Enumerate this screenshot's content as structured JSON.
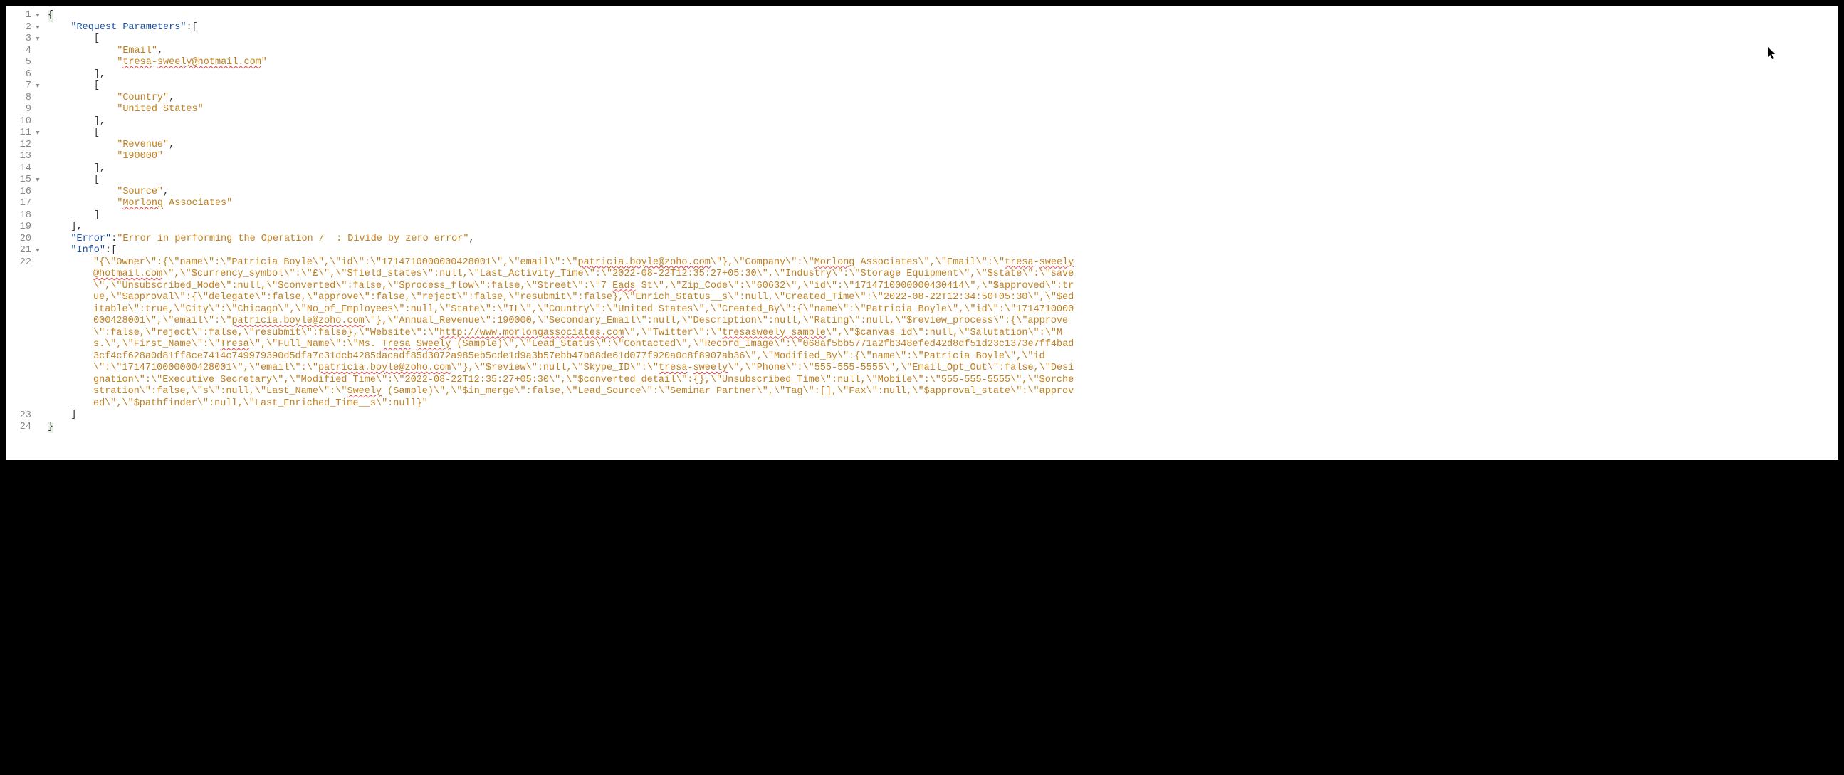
{
  "lines": [
    {
      "num": "1",
      "fold": "▼",
      "indent": 0,
      "segs": [
        {
          "t": "{",
          "c": "p hl"
        }
      ]
    },
    {
      "num": "2",
      "fold": "▼",
      "indent": 1,
      "segs": [
        {
          "t": "\"Request Parameters\"",
          "c": "k"
        },
        {
          "t": ":[",
          "c": "p"
        }
      ]
    },
    {
      "num": "3",
      "fold": "▼",
      "indent": 2,
      "segs": [
        {
          "t": "[",
          "c": "p"
        }
      ]
    },
    {
      "num": "4",
      "fold": "",
      "indent": 3,
      "segs": [
        {
          "t": "\"Email\"",
          "c": "s"
        },
        {
          "t": ",",
          "c": "p"
        }
      ]
    },
    {
      "num": "5",
      "fold": "",
      "indent": 3,
      "segs": [
        {
          "t": "\"",
          "c": "s"
        },
        {
          "t": "tresa",
          "c": "s squiggle"
        },
        {
          "t": "-",
          "c": "s"
        },
        {
          "t": "sweely@hotmail.com",
          "c": "s squiggle"
        },
        {
          "t": "\"",
          "c": "s"
        }
      ]
    },
    {
      "num": "6",
      "fold": "",
      "indent": 2,
      "segs": [
        {
          "t": "],",
          "c": "p"
        }
      ]
    },
    {
      "num": "7",
      "fold": "▼",
      "indent": 2,
      "segs": [
        {
          "t": "[",
          "c": "p"
        }
      ]
    },
    {
      "num": "8",
      "fold": "",
      "indent": 3,
      "segs": [
        {
          "t": "\"Country\"",
          "c": "s"
        },
        {
          "t": ",",
          "c": "p"
        }
      ]
    },
    {
      "num": "9",
      "fold": "",
      "indent": 3,
      "segs": [
        {
          "t": "\"United States\"",
          "c": "s"
        }
      ]
    },
    {
      "num": "10",
      "fold": "",
      "indent": 2,
      "segs": [
        {
          "t": "],",
          "c": "p"
        }
      ]
    },
    {
      "num": "11",
      "fold": "▼",
      "indent": 2,
      "segs": [
        {
          "t": "[",
          "c": "p"
        }
      ]
    },
    {
      "num": "12",
      "fold": "",
      "indent": 3,
      "segs": [
        {
          "t": "\"Revenue\"",
          "c": "s"
        },
        {
          "t": ",",
          "c": "p"
        }
      ]
    },
    {
      "num": "13",
      "fold": "",
      "indent": 3,
      "segs": [
        {
          "t": "\"190000\"",
          "c": "s"
        }
      ]
    },
    {
      "num": "14",
      "fold": "",
      "indent": 2,
      "segs": [
        {
          "t": "],",
          "c": "p"
        }
      ]
    },
    {
      "num": "15",
      "fold": "▼",
      "indent": 2,
      "segs": [
        {
          "t": "[",
          "c": "p"
        }
      ]
    },
    {
      "num": "16",
      "fold": "",
      "indent": 3,
      "segs": [
        {
          "t": "\"Source\"",
          "c": "s"
        },
        {
          "t": ",",
          "c": "p"
        }
      ]
    },
    {
      "num": "17",
      "fold": "",
      "indent": 3,
      "segs": [
        {
          "t": "\"",
          "c": "s"
        },
        {
          "t": "Morlong",
          "c": "s squiggle"
        },
        {
          "t": " Associates\"",
          "c": "s"
        }
      ]
    },
    {
      "num": "18",
      "fold": "",
      "indent": 2,
      "segs": [
        {
          "t": "]",
          "c": "p"
        }
      ]
    },
    {
      "num": "19",
      "fold": "",
      "indent": 1,
      "segs": [
        {
          "t": "],",
          "c": "p"
        }
      ]
    },
    {
      "num": "20",
      "fold": "",
      "indent": 1,
      "segs": [
        {
          "t": "\"Error\"",
          "c": "k"
        },
        {
          "t": ":",
          "c": "p"
        },
        {
          "t": "\"Error in performing the Operation /  : Divide by zero error\"",
          "c": "s"
        },
        {
          "t": ",",
          "c": "p"
        }
      ]
    },
    {
      "num": "21",
      "fold": "▼",
      "indent": 1,
      "segs": [
        {
          "t": "\"Info\"",
          "c": "k"
        },
        {
          "t": ":[",
          "c": "p"
        }
      ]
    }
  ],
  "line22": {
    "num": "22",
    "indent": 2,
    "segments": [
      {
        "t": "\"{\\\"Owner\\\":{\\\"name\\\":\\\"Patricia Boyle\\\",\\\"id\\\":\\\"1714710000000428001\\\",\\\"email\\\":\\\"",
        "sq": false
      },
      {
        "t": "patricia.boyle@zoho.com",
        "sq": true
      },
      {
        "t": "\\\"},\\\"Company\\\":\\\"",
        "sq": false
      },
      {
        "t": "Morlong",
        "sq": true
      },
      {
        "t": " Associates\\\",\\\"Email\\\":\\\"",
        "sq": false
      },
      {
        "t": "tresa",
        "sq": true
      },
      {
        "t": "-",
        "sq": false
      },
      {
        "t": "sweely@hotmail.com",
        "sq": true
      },
      {
        "t": "\\\",\\\"$currency_symbol\\\":\\\"£\\\",\\\"$field_states\\\":null,\\\"Last_Activity_Time\\\":\\\"2022-08-22T12:35:27+05:30\\\",\\\"Industry\\\":\\\"Storage Equipment\\\",\\\"$state\\\":\\\"save\\\",\\\"Unsubscribed_Mode\\\":null,\\\"$converted\\\":false,\\\"$process_flow\\\":false,\\\"Street\\\":\\\"7 ",
        "sq": false
      },
      {
        "t": "Eads",
        "sq": true
      },
      {
        "t": " St\\\",\\\"Zip_Code\\\":\\\"60632\\\",\\\"id\\\":\\\"1714710000000430414\\\",\\\"$approved\\\":true,\\\"$approval\\\":{\\\"delegate\\\":false,\\\"approve\\\":false,\\\"reject\\\":false,\\\"resubmit\\\":false},\\\"Enrich_Status__s\\\":null,\\\"Created_Time\\\":\\\"2022-08-22T12:34:50+05:30\\\",\\\"$editable\\\":true,\\\"City\\\":\\\"Chicago\\\",\\\"No_of_Employees\\\":null,\\\"State\\\":\\\"IL\\\",\\\"Country\\\":\\\"United States\\\",\\\"Created_By\\\":{\\\"name\\\":\\\"Patricia Boyle\\\",\\\"id\\\":\\\"1714710000000428001\\\",\\\"email\\\":\\\"",
        "sq": false
      },
      {
        "t": "patricia.boyle@zoho.com",
        "sq": true
      },
      {
        "t": "\\\"},\\\"Annual_Revenue\\\":190000,\\\"Secondary_Email\\\":null,\\\"Description\\\":null,\\\"Rating\\\":null,\\\"$review_process\\\":{\\\"approve\\\":false,\\\"reject\\\":false,\\\"resubmit\\\":false},\\\"Website\\\":\\\"",
        "sq": false
      },
      {
        "t": "http://www.morlongassociates.com",
        "sq": true
      },
      {
        "t": "\\\",\\\"Twitter\\\":\\\"",
        "sq": false
      },
      {
        "t": "tresasweely_sample",
        "sq": true
      },
      {
        "t": "\\\",\\\"$canvas_id\\\":null,\\\"Salutation\\\":\\\"Ms.\\\",\\\"First_Name\\\":\\\"",
        "sq": false
      },
      {
        "t": "Tresa",
        "sq": true
      },
      {
        "t": "\\\",\\\"Full_Name\\\":\\\"Ms. ",
        "sq": false
      },
      {
        "t": "Tresa",
        "sq": true
      },
      {
        "t": " ",
        "sq": false
      },
      {
        "t": "Sweely",
        "sq": true
      },
      {
        "t": " (Sample)\\\",\\\"Lead_Status\\\":\\\"Contacted\\\",\\\"Record_Image\\\":\\\"068af5bb5771a2fb348efed42d8df51d23c1373e7ff4bad3cf4cf628a0d81ff8ce7414c749979390d5dfa7c31dcb4285dacadf85d3072a985eb5cde1d9a3b57ebb47b88de61d077f920a0c8f8907ab36\\\",\\\"Modified_By\\\":{\\\"name\\\":\\\"Patricia Boyle\\\",\\\"id\\\":\\\"1714710000000428001\\\",\\\"email\\\":\\\"",
        "sq": false
      },
      {
        "t": "patricia.boyle@zoho.com",
        "sq": true
      },
      {
        "t": "\\\"},\\\"$review\\\":null,\\\"Skype_ID\\\":\\\"",
        "sq": false
      },
      {
        "t": "tresa",
        "sq": true
      },
      {
        "t": "-",
        "sq": false
      },
      {
        "t": "sweely",
        "sq": true
      },
      {
        "t": "\\\",\\\"Phone\\\":\\\"555-555-5555\\\",\\\"Email_Opt_Out\\\":false,\\\"Designation\\\":\\\"Executive Secretary\\\",\\\"Modified_Time\\\":\\\"2022-08-22T12:35:27+05:30\\\",\\\"$converted_detail\\\":{},\\\"Unsubscribed_Time\\\":null,\\\"Mobile\\\":\\\"555-555-5555\\\",\\\"$orchestration\\\":false,\\\"s\\\":null,\\\"Last_Name\\\":\\\"",
        "sq": false
      },
      {
        "t": "Sweely",
        "sq": true
      },
      {
        "t": " (Sample)\\\",\\\"$in_merge\\\":false,\\\"Lead_Source\\\":\\\"Seminar Partner\\\",\\\"Tag\\\":[],\\\"Fax\\\":null,\\\"$approval_state\\\":\\\"approved\\\",\\\"$pathfinder\\\":null,\\\"Last_Enriched_Time__s\\\":null}\"",
        "sq": false
      }
    ]
  },
  "line23": {
    "num": "23",
    "indent": 1,
    "text": "]"
  },
  "line24": {
    "num": "24",
    "indent": 0,
    "text": "}"
  },
  "ptr_glyph": "➤"
}
